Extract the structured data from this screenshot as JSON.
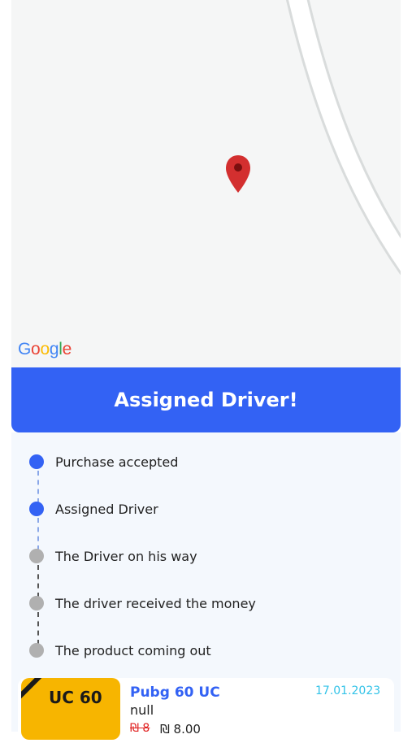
{
  "map": {
    "logo_text": [
      "G",
      "o",
      "o",
      "g",
      "l",
      "e"
    ],
    "logo_colors": [
      "#4285F4",
      "#EA4335",
      "#FBBC05",
      "#4285F4",
      "#34A853",
      "#EA4335"
    ],
    "pin_color": "#d32f2f"
  },
  "banner": {
    "title": "Assigned Driver!",
    "color": "#3362f4"
  },
  "steps": [
    {
      "label": "Purchase accepted",
      "state": "active"
    },
    {
      "label": "Assigned Driver",
      "state": "active"
    },
    {
      "label": "The Driver on his way",
      "state": "inactive"
    },
    {
      "label": "The driver received the money",
      "state": "inactive"
    },
    {
      "label": "The product coming out",
      "state": "inactive"
    }
  ],
  "order": {
    "thumb_text": "UC 60",
    "name": "Pubg 60 UC",
    "subtitle": "null",
    "price_old": "₪ 8",
    "price_new": "₪ 8.00",
    "date": "17.01.2023"
  }
}
